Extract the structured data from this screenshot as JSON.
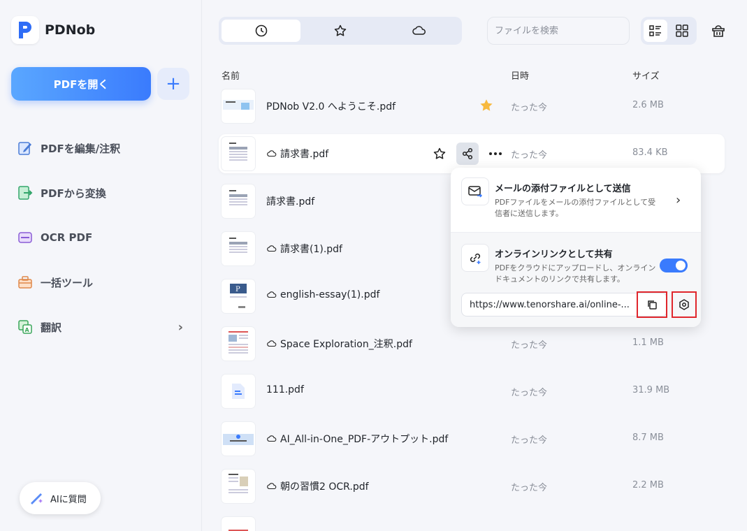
{
  "app": {
    "name": "PDNob"
  },
  "sidebar": {
    "open_label": "PDFを開く",
    "items": [
      {
        "label": "PDFを編集/注釈",
        "icon": "edit-icon"
      },
      {
        "label": "PDFから変換",
        "icon": "convert-icon"
      },
      {
        "label": "OCR PDF",
        "icon": "ocr-icon"
      },
      {
        "label": "一括ツール",
        "icon": "toolbox-icon"
      },
      {
        "label": "翻訳",
        "icon": "translate-icon"
      }
    ],
    "ai_label": "AIに質問"
  },
  "toolbar": {
    "tabs": [
      "recent-icon",
      "star-icon",
      "cloud-icon"
    ],
    "search_placeholder": "ファイルを検索"
  },
  "columns": {
    "name": "名前",
    "date": "日時",
    "size": "サイズ"
  },
  "files": [
    {
      "name": "PDNob V2.0 へようこそ.pdf",
      "cloud": false,
      "date": "たった今",
      "size": "2.6 MB",
      "starred": true
    },
    {
      "name": "請求書.pdf",
      "cloud": true,
      "date": "たった今",
      "size": "83.4 KB"
    },
    {
      "name": "請求書.pdf",
      "cloud": false,
      "date": "",
      "size": ""
    },
    {
      "name": "請求書(1).pdf",
      "cloud": true,
      "date": "",
      "size": ""
    },
    {
      "name": "english-essay(1).pdf",
      "cloud": true,
      "date": "",
      "size": ""
    },
    {
      "name": "Space Exploration_注釈.pdf",
      "cloud": true,
      "date": "たった今",
      "size": "1.1 MB"
    },
    {
      "name": "111.pdf",
      "cloud": false,
      "date": "たった今",
      "size": "31.9 MB"
    },
    {
      "name": "AI_All-in-One_PDF-アウトプット.pdf",
      "cloud": true,
      "date": "たった今",
      "size": "8.7 MB"
    },
    {
      "name": "朝の習慣2 OCR.pdf",
      "cloud": true,
      "date": "たった今",
      "size": "2.2 MB"
    }
  ],
  "share_popup": {
    "email_title": "メールの添付ファイルとして送信",
    "email_desc": "PDFファイルをメールの添付ファイルとして受信者に送信します。",
    "link_title": "オンラインリンクとして共有",
    "link_desc": "PDFをクラウドにアップロードし、オンラインドキュメントのリンクで共有します。",
    "link_url": "https://www.tenorshare.ai/online-...",
    "toggle_on": true
  },
  "colors": {
    "accent": "#3a7bfd",
    "star": "#f7b93e",
    "highlight": "#e0262c"
  }
}
